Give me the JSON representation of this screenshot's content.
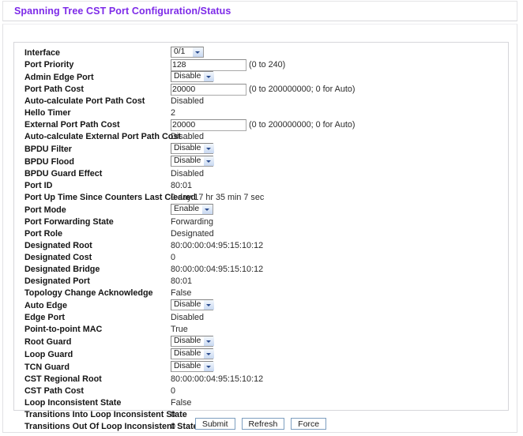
{
  "header": {
    "title": "Spanning Tree CST Port Configuration/Status",
    "title_color": "#7d2ae8"
  },
  "form": {
    "rows": [
      {
        "label": "Interface",
        "type": "select",
        "value": "0/1",
        "width": "narrow"
      },
      {
        "label": "Port Priority",
        "type": "input",
        "value": "128",
        "hint": "(0 to 240)"
      },
      {
        "label": "Admin Edge Port",
        "type": "select",
        "value": "Disable",
        "width": "wide"
      },
      {
        "label": "Port Path Cost",
        "type": "input",
        "value": "20000",
        "hint": "(0 to 200000000; 0 for Auto)"
      },
      {
        "label": "Auto-calculate Port Path Cost",
        "type": "static",
        "value": "Disabled"
      },
      {
        "label": "Hello Timer",
        "type": "static",
        "value": "2"
      },
      {
        "label": "External Port Path Cost",
        "type": "input",
        "value": "20000",
        "hint": "(0 to 200000000; 0 for Auto)"
      },
      {
        "label": "Auto-calculate External Port Path Cost",
        "type": "static",
        "value": "Disabled"
      },
      {
        "label": "BPDU Filter",
        "type": "select",
        "value": "Disable",
        "width": "wide"
      },
      {
        "label": "BPDU Flood",
        "type": "select",
        "value": "Disable",
        "width": "wide"
      },
      {
        "label": "BPDU Guard Effect",
        "type": "static",
        "value": "Disabled"
      },
      {
        "label": "Port ID",
        "type": "static",
        "value": "80:01"
      },
      {
        "label": "Port Up Time Since Counters Last Cleared",
        "type": "static",
        "value": "0 day 17 hr 35 min 7 sec"
      },
      {
        "label": "Port Mode",
        "type": "select",
        "value": "Enable",
        "width": "wide"
      },
      {
        "label": "Port Forwarding State",
        "type": "static",
        "value": "Forwarding"
      },
      {
        "label": "Port Role",
        "type": "static",
        "value": "Designated"
      },
      {
        "label": "Designated Root",
        "type": "static",
        "value": "80:00:00:04:95:15:10:12"
      },
      {
        "label": "Designated Cost",
        "type": "static",
        "value": "0"
      },
      {
        "label": "Designated Bridge",
        "type": "static",
        "value": "80:00:00:04:95:15:10:12"
      },
      {
        "label": "Designated Port",
        "type": "static",
        "value": "80:01"
      },
      {
        "label": "Topology Change Acknowledge",
        "type": "static",
        "value": "False"
      },
      {
        "label": "Auto Edge",
        "type": "select",
        "value": "Disable",
        "width": "wide"
      },
      {
        "label": "Edge Port",
        "type": "static",
        "value": "Disabled"
      },
      {
        "label": "Point-to-point MAC",
        "type": "static",
        "value": "True"
      },
      {
        "label": "Root Guard",
        "type": "select",
        "value": "Disable",
        "width": "wide"
      },
      {
        "label": "Loop Guard",
        "type": "select",
        "value": "Disable",
        "width": "wide"
      },
      {
        "label": "TCN Guard",
        "type": "select",
        "value": "Disable",
        "width": "wide"
      },
      {
        "label": "CST Regional Root",
        "type": "static",
        "value": "80:00:00:04:95:15:10:12"
      },
      {
        "label": "CST Path Cost",
        "type": "static",
        "value": "0"
      },
      {
        "label": "Loop Inconsistent State",
        "type": "static",
        "value": "False"
      },
      {
        "label": "Transitions Into Loop Inconsistent State",
        "type": "static",
        "value": "0"
      },
      {
        "label": "Transitions Out Of Loop Inconsistent State",
        "type": "static",
        "value": "0"
      }
    ]
  },
  "buttons": [
    {
      "label": "Submit",
      "name": "submit-button"
    },
    {
      "label": "Refresh",
      "name": "refresh-button"
    },
    {
      "label": "Force",
      "name": "force-button"
    }
  ]
}
